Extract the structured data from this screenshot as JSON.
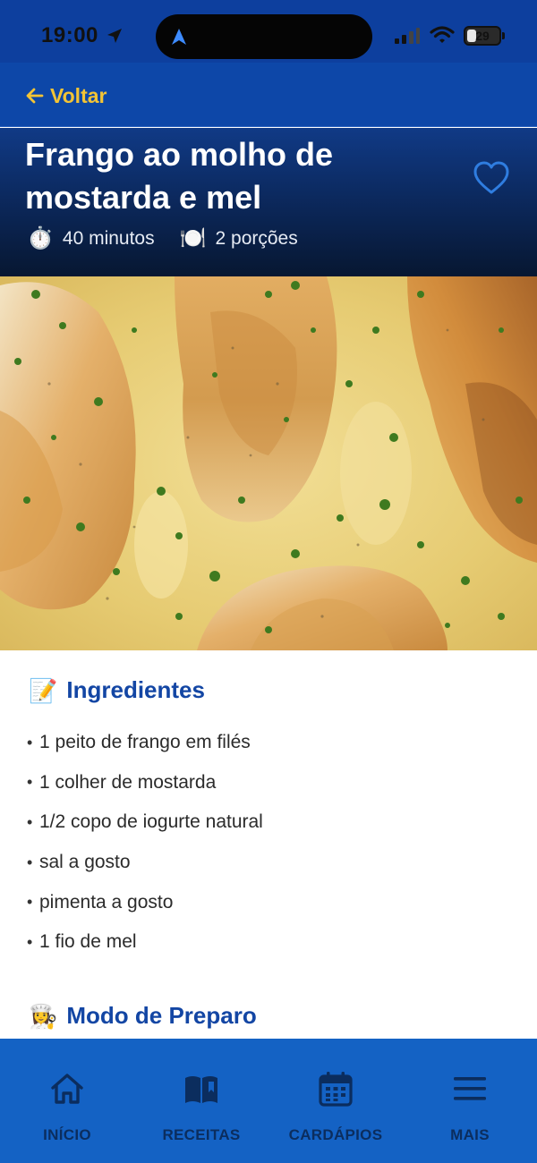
{
  "status_bar": {
    "time": "19:00",
    "battery": "29",
    "battery_level": 0.29
  },
  "nav": {
    "back_label": "Voltar"
  },
  "recipe": {
    "title": "Frango ao molho de mostarda e mel",
    "time_icon": "⏱️",
    "time": "40 minutos",
    "servings_icon": "🍽️",
    "servings": "2 porções",
    "favorite": false
  },
  "ingredients_section": {
    "emoji": "📝",
    "title": "Ingredientes",
    "items": [
      "1 peito de frango em filés",
      "1 colher de mostarda",
      "1/2 copo de iogurte natural",
      "sal a gosto",
      "pimenta a gosto",
      "1 fio de mel"
    ]
  },
  "preparation_section": {
    "emoji": "👩‍🍳",
    "title": "Modo de Preparo"
  },
  "tabbar": {
    "tabs": [
      {
        "label": "INÍCIO",
        "icon": "home-icon"
      },
      {
        "label": "RECEITAS",
        "icon": "book-icon"
      },
      {
        "label": "CARDÁPIOS",
        "icon": "calendar-icon"
      },
      {
        "label": "MAIS",
        "icon": "menu-icon"
      }
    ]
  },
  "colors": {
    "nav_blue": "#0d47a8",
    "accent_yellow": "#f3c435",
    "section_title_blue": "#1346a4",
    "tabbar_blue": "#1462c4",
    "heart_blue": "#2f7de0"
  }
}
